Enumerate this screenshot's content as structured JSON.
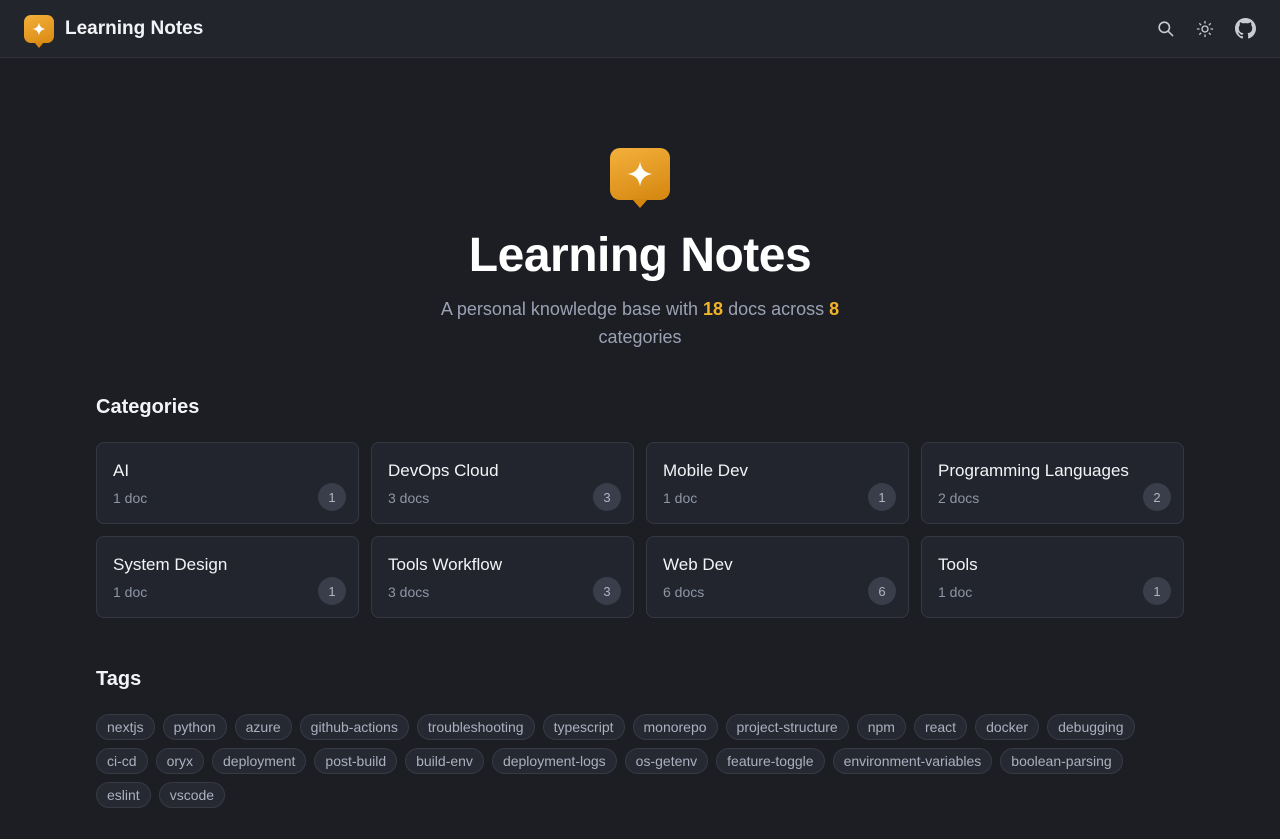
{
  "app": {
    "title": "Learning Notes"
  },
  "header": {
    "actions": [
      {
        "icon": "search-icon"
      },
      {
        "icon": "sun-icon"
      },
      {
        "icon": "github-icon"
      }
    ]
  },
  "hero": {
    "title": "Learning Notes",
    "sub_prefix": "A personal knowledge base with ",
    "doc_count": "18",
    "sub_middle": " docs across ",
    "category_count": "8",
    "sub_suffix": " categories"
  },
  "colors": {
    "accent": "#f0b32a",
    "background": "#1c1e24",
    "card": "#22252d"
  },
  "categories": {
    "heading": "Categories",
    "items": [
      {
        "name": "AI",
        "docs": "1 doc",
        "count": "1"
      },
      {
        "name": "DevOps Cloud",
        "docs": "3 docs",
        "count": "3"
      },
      {
        "name": "Mobile Dev",
        "docs": "1 doc",
        "count": "1"
      },
      {
        "name": "Programming Languages",
        "docs": "2 docs",
        "count": "2"
      },
      {
        "name": "System Design",
        "docs": "1 doc",
        "count": "1"
      },
      {
        "name": "Tools Workflow",
        "docs": "3 docs",
        "count": "3"
      },
      {
        "name": "Web Dev",
        "docs": "6 docs",
        "count": "6"
      },
      {
        "name": "Tools",
        "docs": "1 doc",
        "count": "1"
      }
    ]
  },
  "tags": {
    "heading": "Tags",
    "items": [
      "nextjs",
      "python",
      "azure",
      "github-actions",
      "troubleshooting",
      "typescript",
      "monorepo",
      "project-structure",
      "npm",
      "react",
      "docker",
      "debugging",
      "ci-cd",
      "oryx",
      "deployment",
      "post-build",
      "build-env",
      "deployment-logs",
      "os-getenv",
      "feature-toggle",
      "environment-variables",
      "boolean-parsing",
      "eslint",
      "vscode"
    ]
  }
}
